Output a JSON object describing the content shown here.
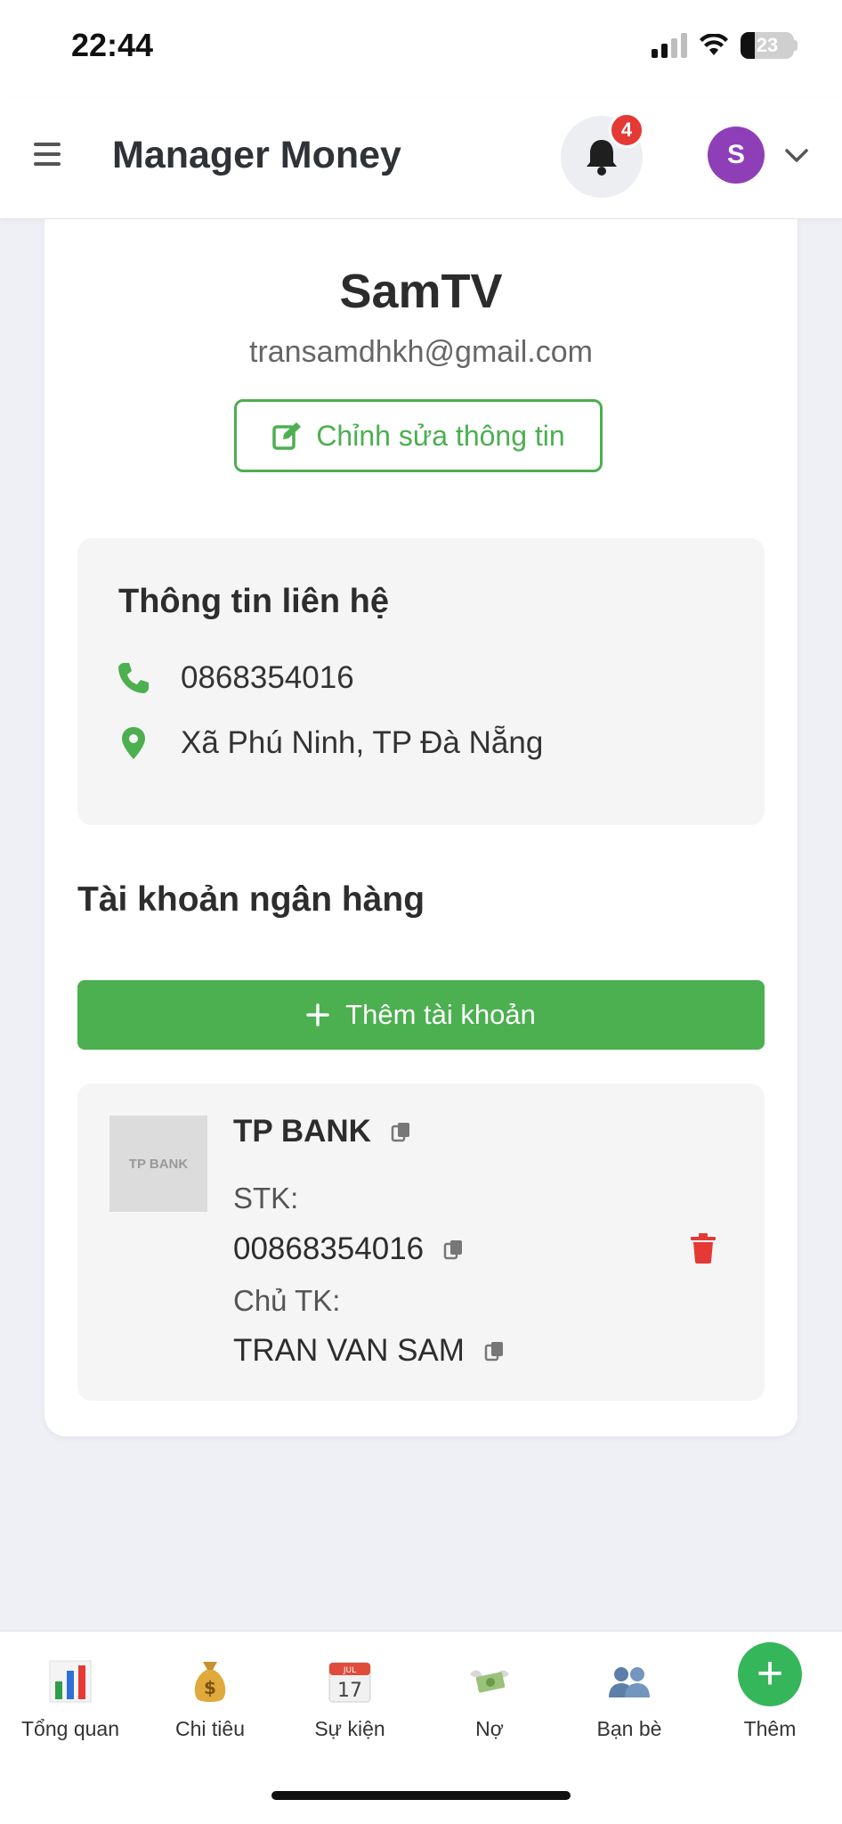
{
  "status_bar": {
    "time": "22:44",
    "battery": "23"
  },
  "header": {
    "title": "Manager Money",
    "notification_count": "4",
    "avatar_initial": "S"
  },
  "profile": {
    "name": "SamTV",
    "email": "transamdhkh@gmail.com",
    "edit_label": "Chỉnh sửa thông tin"
  },
  "contact": {
    "title": "Thông tin liên hệ",
    "phone": "0868354016",
    "address": "Xã Phú Ninh, TP Đà Nẵng"
  },
  "bank_section": {
    "title": "Tài khoản ngân hàng",
    "add_label": "Thêm tài khoản",
    "accounts": [
      {
        "logo_text": "TP BANK",
        "bank_name": "TP BANK",
        "number_label": "STK:",
        "number": "00868354016",
        "owner_label": "Chủ TK:",
        "owner": "TRAN VAN SAM"
      }
    ]
  },
  "bottom_nav": {
    "items": [
      {
        "label": "Tổng quan",
        "icon": "bar-chart-icon"
      },
      {
        "label": "Chi tiêu",
        "icon": "money-bag-icon"
      },
      {
        "label": "Sự kiện",
        "icon": "calendar-icon",
        "calendar_month": "JUL",
        "calendar_day": "17"
      },
      {
        "label": "Nợ",
        "icon": "money-wings-icon"
      },
      {
        "label": "Bạn bè",
        "icon": "friends-icon"
      },
      {
        "label": "Thêm",
        "icon": "plus-icon"
      }
    ]
  },
  "colors": {
    "accent_green": "#4caf50",
    "danger_red": "#e53935",
    "avatar_purple": "#8e3fb8"
  }
}
